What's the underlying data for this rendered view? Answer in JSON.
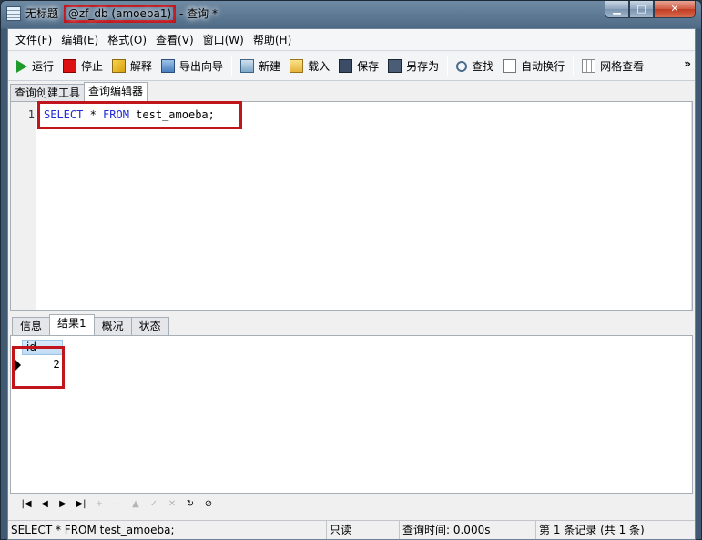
{
  "window": {
    "title_prefix": "无标题",
    "connection": "@zf_db (amoeba1)",
    "title_suffix": " - 查询 *",
    "minimize": "▁",
    "maximize": "□",
    "close": "✕"
  },
  "menu": [
    "文件(F)",
    "编辑(E)",
    "格式(O)",
    "查看(V)",
    "窗口(W)",
    "帮助(H)"
  ],
  "toolbar": {
    "run": "运行",
    "stop": "停止",
    "explain": "解释",
    "export_wizard": "导出向导",
    "new": "新建",
    "load": "载入",
    "save": "保存",
    "save_as": "另存为",
    "find": "查找",
    "word_wrap": "自动换行",
    "grid_view": "网格查看",
    "more": "»"
  },
  "top_tabs": [
    "查询创建工具",
    "查询编辑器"
  ],
  "editor": {
    "line_number": "1",
    "kw_select": "SELECT",
    "star": " * ",
    "kw_from": "FROM",
    "table": " test_amoeba;"
  },
  "bottom_tabs": [
    "信息",
    "结果1",
    "概况",
    "状态"
  ],
  "results": {
    "column": "id",
    "value": "2"
  },
  "nav": [
    "|◀",
    "◀",
    "▶",
    "▶|",
    "+",
    "—",
    "▲",
    "✓",
    "✕",
    "↻",
    "⊘"
  ],
  "status": {
    "sql": "SELECT * FROM test_amoeba;",
    "mode": "只读",
    "query_time": "查询时间: 0.000s",
    "records": "第 1 条记录 (共 1 条)"
  }
}
